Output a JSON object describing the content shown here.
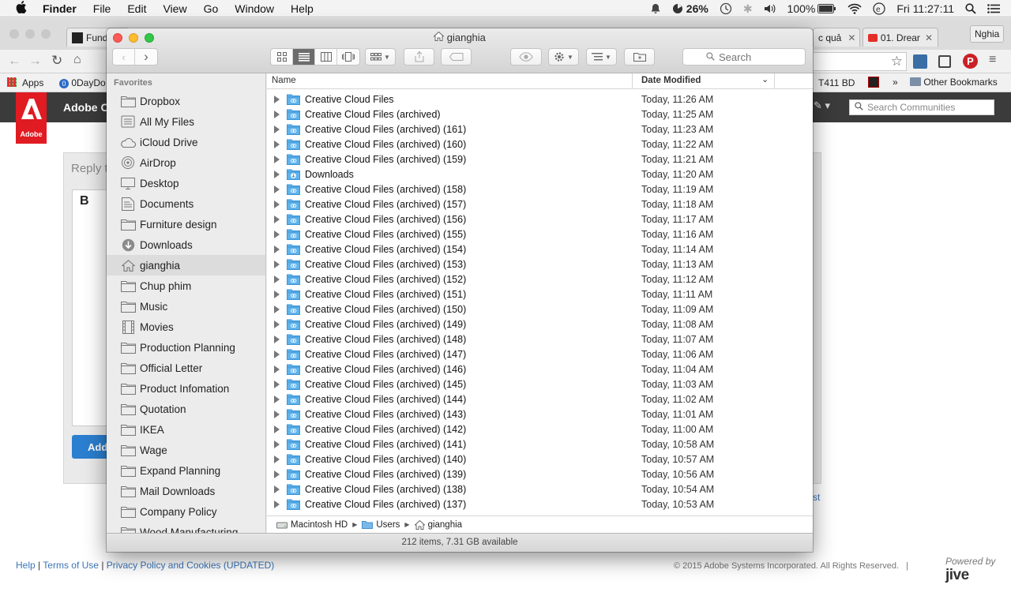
{
  "menubar": {
    "app_name": "Finder",
    "items": [
      "File",
      "Edit",
      "View",
      "Go",
      "Window",
      "Help"
    ],
    "cpu_percent": "26%",
    "battery": "100%",
    "clock": "Fri 11:27:11"
  },
  "chrome": {
    "tabs": [
      {
        "label": "Fundy"
      },
      {
        "label": "c quả"
      },
      {
        "label": "01. Drear"
      }
    ],
    "profile": "Nghia",
    "bookmarks": {
      "apps": "Apps",
      "odaydo": "0DayDo",
      "t411": "T411 BD",
      "more": "»",
      "other": "Other Bookmarks"
    }
  },
  "adobe_page": {
    "logo_text": "Adobe",
    "community_name": "Adobe Co",
    "search_placeholder": "Search Communities",
    "reply_label": "Reply t",
    "editor_bold": "B",
    "add_button": "Add",
    "link_fragment": "st",
    "footer_links": [
      "Help",
      "Terms of Use",
      "Privacy Policy and Cookies (UPDATED)"
    ],
    "footer_sep": "|",
    "copyright": "© 2015 Adobe Systems Incorporated. All Rights Reserved.",
    "copyright_sep": "|",
    "powered_by": "Powered by",
    "jive": "jive"
  },
  "finder": {
    "title": "gianghia",
    "search_placeholder": "Search",
    "sidebar_header": "Favorites",
    "sidebar_items": [
      {
        "label": "Dropbox",
        "icon": "folder-icon"
      },
      {
        "label": "All My Files",
        "icon": "all-files-icon"
      },
      {
        "label": "iCloud Drive",
        "icon": "cloud-icon"
      },
      {
        "label": "AirDrop",
        "icon": "airdrop-icon"
      },
      {
        "label": "Desktop",
        "icon": "desktop-icon"
      },
      {
        "label": "Documents",
        "icon": "documents-icon"
      },
      {
        "label": "Furniture design",
        "icon": "folder-icon"
      },
      {
        "label": "Downloads",
        "icon": "downloads-icon"
      },
      {
        "label": "gianghia",
        "icon": "home-icon",
        "selected": true
      },
      {
        "label": "Chup phim",
        "icon": "folder-icon"
      },
      {
        "label": "Music",
        "icon": "folder-icon"
      },
      {
        "label": "Movies",
        "icon": "movies-icon"
      },
      {
        "label": "Production Planning",
        "icon": "folder-icon"
      },
      {
        "label": "Official Letter",
        "icon": "folder-icon"
      },
      {
        "label": "Product Infomation",
        "icon": "folder-icon"
      },
      {
        "label": "Quotation",
        "icon": "folder-icon"
      },
      {
        "label": "IKEA",
        "icon": "folder-icon"
      },
      {
        "label": "Wage",
        "icon": "folder-icon"
      },
      {
        "label": "Expand Planning",
        "icon": "folder-icon"
      },
      {
        "label": "Mail Downloads",
        "icon": "folder-icon"
      },
      {
        "label": "Company Policy",
        "icon": "folder-icon"
      },
      {
        "label": "Wood Manufacturing",
        "icon": "folder-icon"
      }
    ],
    "columns": {
      "name": "Name",
      "date": "Date Modified"
    },
    "rows": [
      {
        "name": "Creative Cloud Files",
        "date": "Today, 11:26 AM"
      },
      {
        "name": "Creative Cloud Files (archived)",
        "date": "Today, 11:25 AM"
      },
      {
        "name": "Creative Cloud Files (archived) (161)",
        "date": "Today, 11:23 AM"
      },
      {
        "name": "Creative Cloud Files (archived) (160)",
        "date": "Today, 11:22 AM"
      },
      {
        "name": "Creative Cloud Files (archived) (159)",
        "date": "Today, 11:21 AM"
      },
      {
        "name": "Downloads",
        "date": "Today, 11:20 AM",
        "icon": "downloads"
      },
      {
        "name": "Creative Cloud Files (archived) (158)",
        "date": "Today, 11:19 AM"
      },
      {
        "name": "Creative Cloud Files (archived) (157)",
        "date": "Today, 11:18 AM"
      },
      {
        "name": "Creative Cloud Files (archived) (156)",
        "date": "Today, 11:17 AM"
      },
      {
        "name": "Creative Cloud Files (archived) (155)",
        "date": "Today, 11:16 AM"
      },
      {
        "name": "Creative Cloud Files (archived) (154)",
        "date": "Today, 11:14 AM"
      },
      {
        "name": "Creative Cloud Files (archived) (153)",
        "date": "Today, 11:13 AM"
      },
      {
        "name": "Creative Cloud Files (archived) (152)",
        "date": "Today, 11:12 AM"
      },
      {
        "name": "Creative Cloud Files (archived) (151)",
        "date": "Today, 11:11 AM"
      },
      {
        "name": "Creative Cloud Files (archived) (150)",
        "date": "Today, 11:09 AM"
      },
      {
        "name": "Creative Cloud Files (archived) (149)",
        "date": "Today, 11:08 AM"
      },
      {
        "name": "Creative Cloud Files (archived) (148)",
        "date": "Today, 11:07 AM"
      },
      {
        "name": "Creative Cloud Files (archived) (147)",
        "date": "Today, 11:06 AM"
      },
      {
        "name": "Creative Cloud Files (archived) (146)",
        "date": "Today, 11:04 AM"
      },
      {
        "name": "Creative Cloud Files (archived) (145)",
        "date": "Today, 11:03 AM"
      },
      {
        "name": "Creative Cloud Files (archived) (144)",
        "date": "Today, 11:02 AM"
      },
      {
        "name": "Creative Cloud Files (archived) (143)",
        "date": "Today, 11:01 AM"
      },
      {
        "name": "Creative Cloud Files (archived) (142)",
        "date": "Today, 11:00 AM"
      },
      {
        "name": "Creative Cloud Files (archived) (141)",
        "date": "Today, 10:58 AM"
      },
      {
        "name": "Creative Cloud Files (archived) (140)",
        "date": "Today, 10:57 AM"
      },
      {
        "name": "Creative Cloud Files (archived) (139)",
        "date": "Today, 10:56 AM"
      },
      {
        "name": "Creative Cloud Files (archived) (138)",
        "date": "Today, 10:54 AM"
      },
      {
        "name": "Creative Cloud Files (archived) (137)",
        "date": "Today, 10:53 AM"
      }
    ],
    "path": [
      "Macintosh HD",
      "Users",
      "gianghia"
    ],
    "status": "212 items, 7.31 GB available"
  },
  "colors": {
    "folder_blue": "#5fb3ec",
    "close": "#fc5b57",
    "minimize": "#fdbc2e",
    "maximize": "#33c748",
    "adobe_red": "#e01b22"
  }
}
